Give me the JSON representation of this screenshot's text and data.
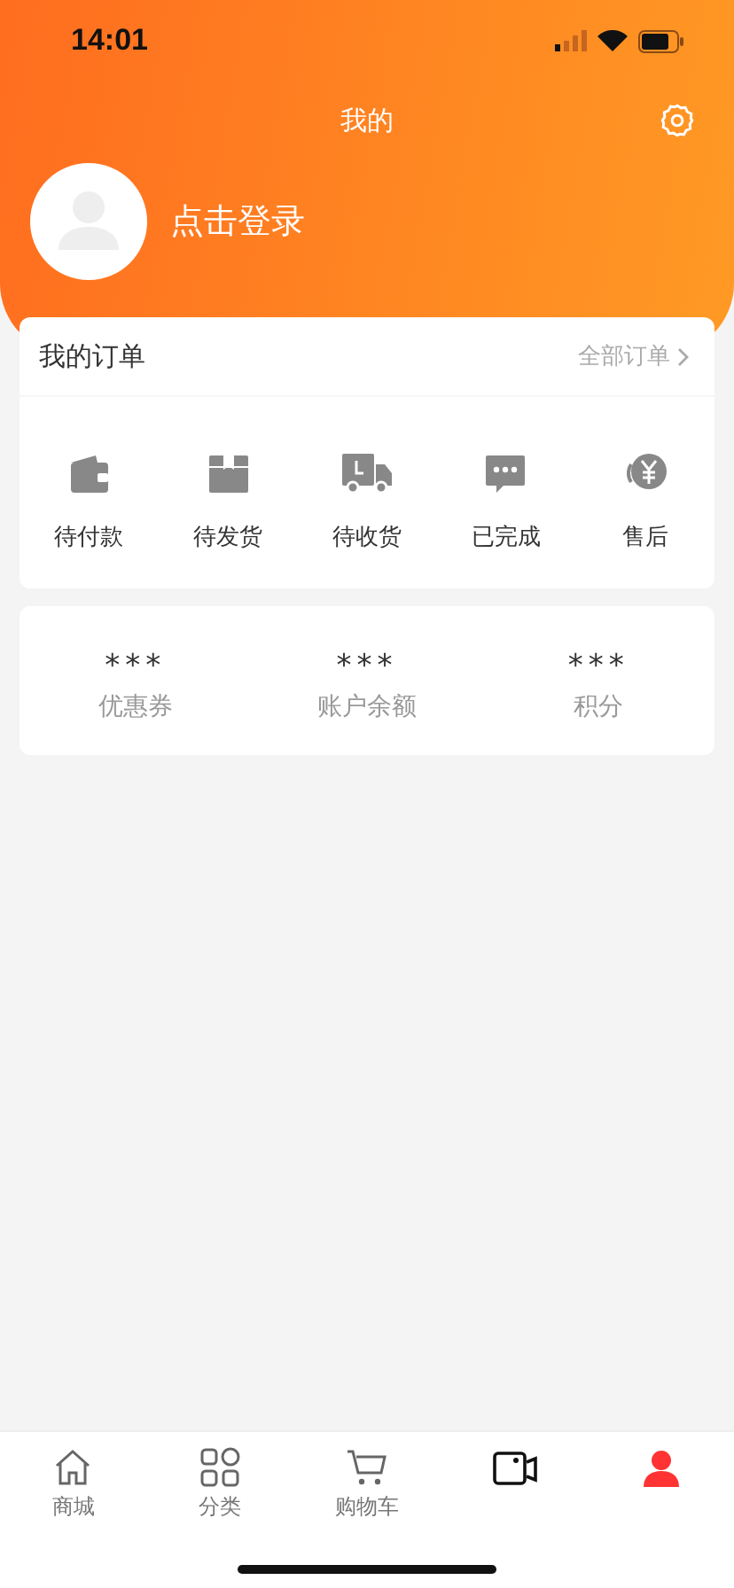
{
  "status_bar": {
    "time": "14:01"
  },
  "header": {
    "title": "我的",
    "login": "点击登录"
  },
  "orders": {
    "title": "我的订单",
    "all_link": "全部订单",
    "items": [
      {
        "kind": "wallet",
        "label": "待付款"
      },
      {
        "kind": "box",
        "label": "待发货"
      },
      {
        "kind": "truck",
        "label": "待收货"
      },
      {
        "kind": "chat",
        "label": "已完成"
      },
      {
        "kind": "refund",
        "label": "售后"
      }
    ]
  },
  "assets": [
    {
      "value": "***",
      "label": "优惠券"
    },
    {
      "value": "***",
      "label": "账户余额"
    },
    {
      "value": "***",
      "label": "积分"
    }
  ],
  "tab_bar": [
    {
      "kind": "home",
      "label": "商城",
      "selected": false
    },
    {
      "kind": "grid",
      "label": "分类",
      "selected": false
    },
    {
      "kind": "cart",
      "label": "购物车",
      "selected": false
    },
    {
      "kind": "video",
      "selected": false
    },
    {
      "kind": "user",
      "selected": true
    }
  ]
}
